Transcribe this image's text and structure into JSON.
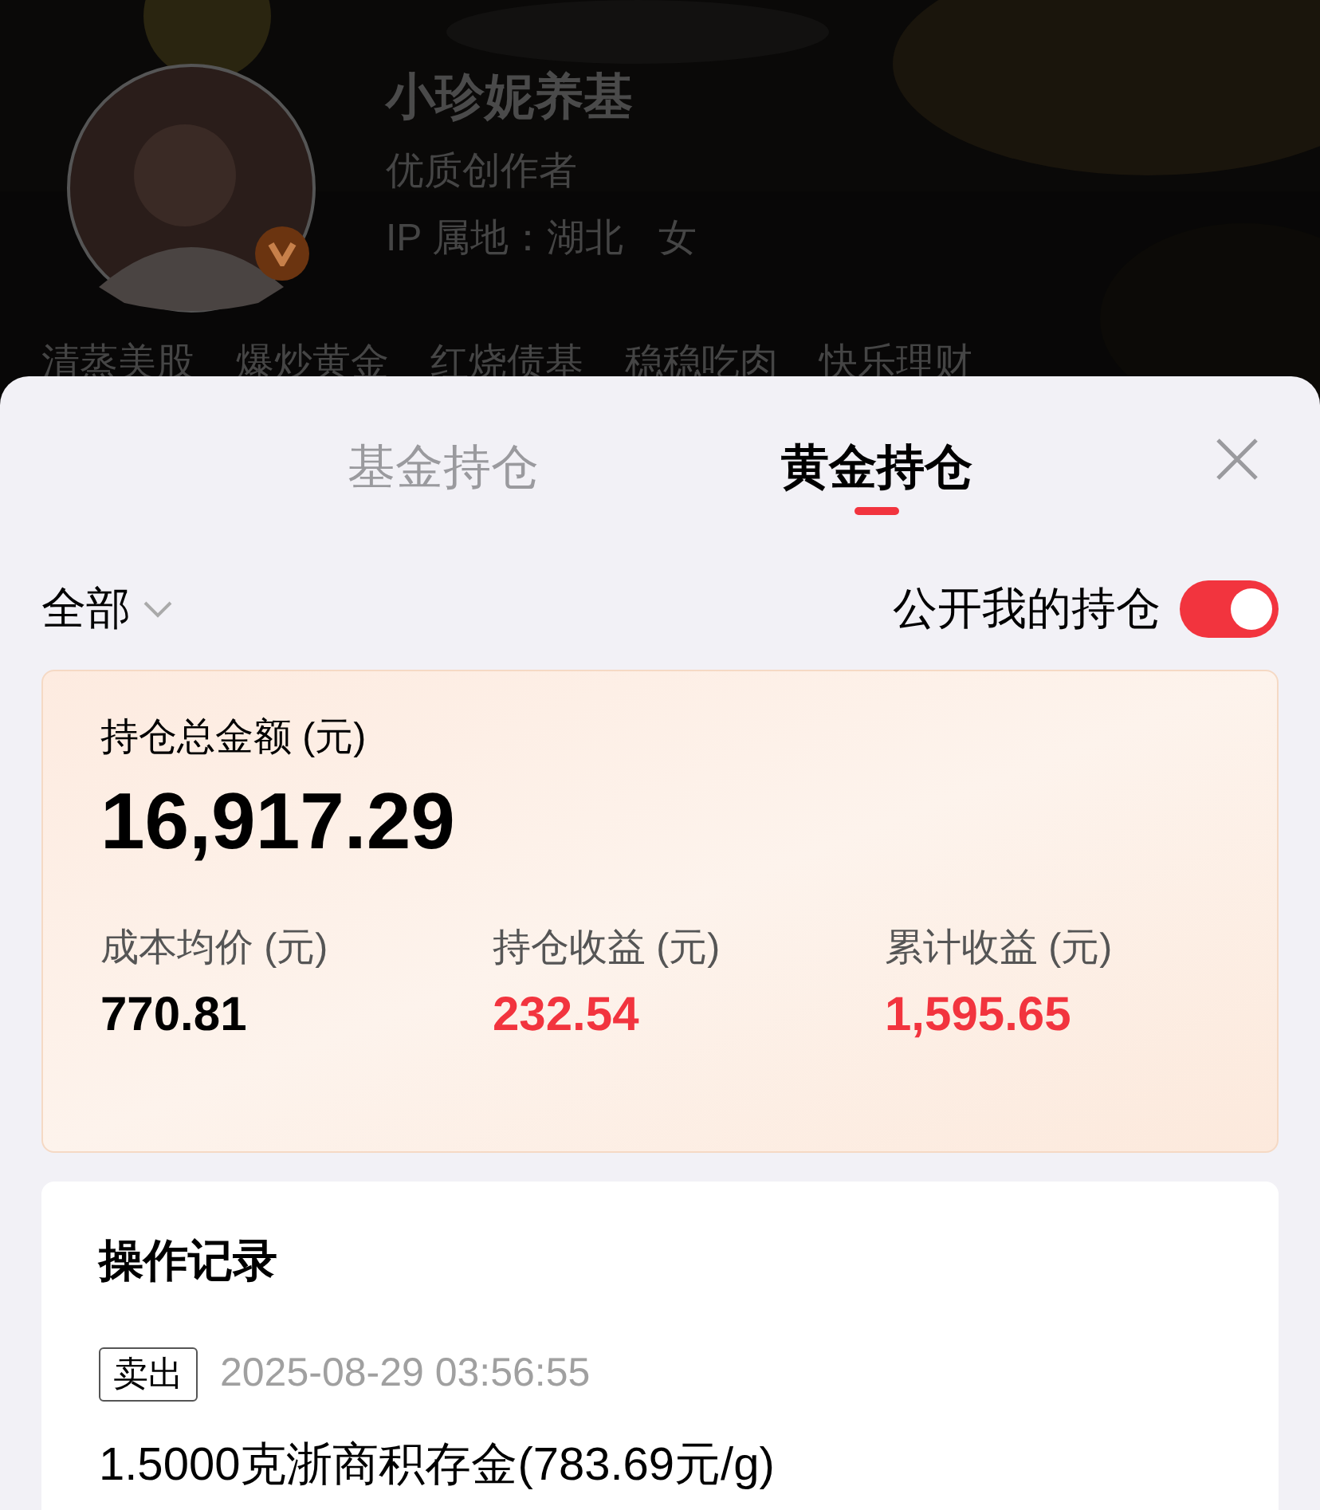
{
  "profile": {
    "name": "小珍妮养基",
    "title": "优质创作者",
    "ip_label": "IP 属地：",
    "ip_location": "湖北",
    "gender": "女",
    "verified": true,
    "tags": [
      "清蒸美股",
      "爆炒黄金",
      "红烧债基",
      "稳稳吃肉",
      "快乐理财"
    ]
  },
  "tabs": [
    {
      "label": "基金持仓",
      "selected": false
    },
    {
      "label": "黄金持仓",
      "selected": true
    }
  ],
  "filter": {
    "label": "全部"
  },
  "public_toggle": {
    "label": "公开我的持仓",
    "on": true
  },
  "summary": {
    "total_label": "持仓总金额 (元)",
    "total": "16,917.29",
    "stats": [
      {
        "label": "成本均价 (元)",
        "value": "770.81",
        "positive": false
      },
      {
        "label": "持仓收益 (元)",
        "value": "232.54",
        "positive": true
      },
      {
        "label": "累计收益 (元)",
        "value": "1,595.65",
        "positive": true
      }
    ]
  },
  "records": {
    "title": "操作记录",
    "items": [
      {
        "type": "卖出",
        "time": "2025-08-29 03:56:55",
        "detail": "1.5000克浙商积存金(783.69元/g)"
      }
    ]
  }
}
